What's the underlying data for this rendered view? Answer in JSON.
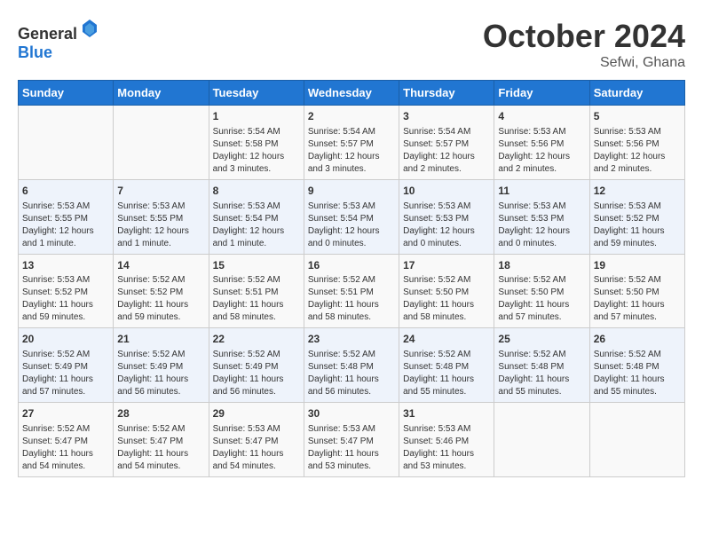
{
  "header": {
    "logo_general": "General",
    "logo_blue": "Blue",
    "month_title": "October 2024",
    "location": "Sefwi, Ghana"
  },
  "weekdays": [
    "Sunday",
    "Monday",
    "Tuesday",
    "Wednesday",
    "Thursday",
    "Friday",
    "Saturday"
  ],
  "weeks": [
    [
      {
        "day": "",
        "info": ""
      },
      {
        "day": "",
        "info": ""
      },
      {
        "day": "1",
        "info": "Sunrise: 5:54 AM\nSunset: 5:58 PM\nDaylight: 12 hours and 3 minutes."
      },
      {
        "day": "2",
        "info": "Sunrise: 5:54 AM\nSunset: 5:57 PM\nDaylight: 12 hours and 3 minutes."
      },
      {
        "day": "3",
        "info": "Sunrise: 5:54 AM\nSunset: 5:57 PM\nDaylight: 12 hours and 2 minutes."
      },
      {
        "day": "4",
        "info": "Sunrise: 5:53 AM\nSunset: 5:56 PM\nDaylight: 12 hours and 2 minutes."
      },
      {
        "day": "5",
        "info": "Sunrise: 5:53 AM\nSunset: 5:56 PM\nDaylight: 12 hours and 2 minutes."
      }
    ],
    [
      {
        "day": "6",
        "info": "Sunrise: 5:53 AM\nSunset: 5:55 PM\nDaylight: 12 hours and 1 minute."
      },
      {
        "day": "7",
        "info": "Sunrise: 5:53 AM\nSunset: 5:55 PM\nDaylight: 12 hours and 1 minute."
      },
      {
        "day": "8",
        "info": "Sunrise: 5:53 AM\nSunset: 5:54 PM\nDaylight: 12 hours and 1 minute."
      },
      {
        "day": "9",
        "info": "Sunrise: 5:53 AM\nSunset: 5:54 PM\nDaylight: 12 hours and 0 minutes."
      },
      {
        "day": "10",
        "info": "Sunrise: 5:53 AM\nSunset: 5:53 PM\nDaylight: 12 hours and 0 minutes."
      },
      {
        "day": "11",
        "info": "Sunrise: 5:53 AM\nSunset: 5:53 PM\nDaylight: 12 hours and 0 minutes."
      },
      {
        "day": "12",
        "info": "Sunrise: 5:53 AM\nSunset: 5:52 PM\nDaylight: 11 hours and 59 minutes."
      }
    ],
    [
      {
        "day": "13",
        "info": "Sunrise: 5:53 AM\nSunset: 5:52 PM\nDaylight: 11 hours and 59 minutes."
      },
      {
        "day": "14",
        "info": "Sunrise: 5:52 AM\nSunset: 5:52 PM\nDaylight: 11 hours and 59 minutes."
      },
      {
        "day": "15",
        "info": "Sunrise: 5:52 AM\nSunset: 5:51 PM\nDaylight: 11 hours and 58 minutes."
      },
      {
        "day": "16",
        "info": "Sunrise: 5:52 AM\nSunset: 5:51 PM\nDaylight: 11 hours and 58 minutes."
      },
      {
        "day": "17",
        "info": "Sunrise: 5:52 AM\nSunset: 5:50 PM\nDaylight: 11 hours and 58 minutes."
      },
      {
        "day": "18",
        "info": "Sunrise: 5:52 AM\nSunset: 5:50 PM\nDaylight: 11 hours and 57 minutes."
      },
      {
        "day": "19",
        "info": "Sunrise: 5:52 AM\nSunset: 5:50 PM\nDaylight: 11 hours and 57 minutes."
      }
    ],
    [
      {
        "day": "20",
        "info": "Sunrise: 5:52 AM\nSunset: 5:49 PM\nDaylight: 11 hours and 57 minutes."
      },
      {
        "day": "21",
        "info": "Sunrise: 5:52 AM\nSunset: 5:49 PM\nDaylight: 11 hours and 56 minutes."
      },
      {
        "day": "22",
        "info": "Sunrise: 5:52 AM\nSunset: 5:49 PM\nDaylight: 11 hours and 56 minutes."
      },
      {
        "day": "23",
        "info": "Sunrise: 5:52 AM\nSunset: 5:48 PM\nDaylight: 11 hours and 56 minutes."
      },
      {
        "day": "24",
        "info": "Sunrise: 5:52 AM\nSunset: 5:48 PM\nDaylight: 11 hours and 55 minutes."
      },
      {
        "day": "25",
        "info": "Sunrise: 5:52 AM\nSunset: 5:48 PM\nDaylight: 11 hours and 55 minutes."
      },
      {
        "day": "26",
        "info": "Sunrise: 5:52 AM\nSunset: 5:48 PM\nDaylight: 11 hours and 55 minutes."
      }
    ],
    [
      {
        "day": "27",
        "info": "Sunrise: 5:52 AM\nSunset: 5:47 PM\nDaylight: 11 hours and 54 minutes."
      },
      {
        "day": "28",
        "info": "Sunrise: 5:52 AM\nSunset: 5:47 PM\nDaylight: 11 hours and 54 minutes."
      },
      {
        "day": "29",
        "info": "Sunrise: 5:53 AM\nSunset: 5:47 PM\nDaylight: 11 hours and 54 minutes."
      },
      {
        "day": "30",
        "info": "Sunrise: 5:53 AM\nSunset: 5:47 PM\nDaylight: 11 hours and 53 minutes."
      },
      {
        "day": "31",
        "info": "Sunrise: 5:53 AM\nSunset: 5:46 PM\nDaylight: 11 hours and 53 minutes."
      },
      {
        "day": "",
        "info": ""
      },
      {
        "day": "",
        "info": ""
      }
    ]
  ]
}
